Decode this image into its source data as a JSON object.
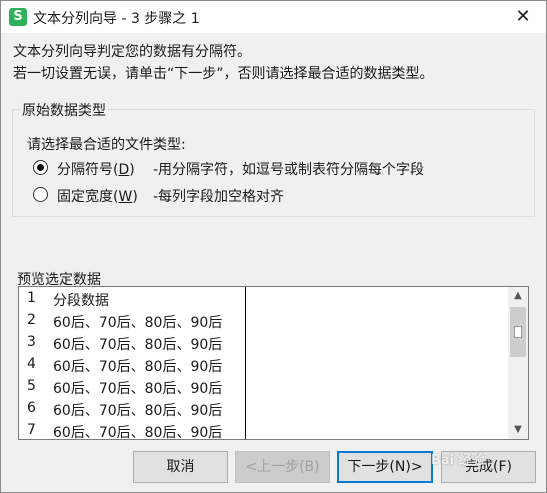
{
  "window": {
    "title": "文本分列向导 - 3 步骤之 1",
    "app_icon_glyph": "S",
    "app_icon_color": "#2fb15a",
    "close_glyph": "✕"
  },
  "intro": {
    "line1": "文本分列向导判定您的数据有分隔符。",
    "line2": "若一切设置无误，请单击“下一步”，否则请选择最合适的数据类型。"
  },
  "group": {
    "legend": "原始数据类型",
    "prompt": "请选择最合适的文件类型:",
    "options": [
      {
        "label": "分隔符号(",
        "key": "D",
        "suffix": ")",
        "description": "-用分隔字符，如逗号或制表符分隔每个字段",
        "selected": true
      },
      {
        "label": "固定宽度(",
        "key": "W",
        "suffix": ")",
        "description": "-每列字段加空格对齐",
        "selected": false
      }
    ]
  },
  "preview": {
    "label": "预览选定数据",
    "rows": [
      {
        "num": "1",
        "text": "分段数据"
      },
      {
        "num": "2",
        "text": "60后、70后、80后、90后"
      },
      {
        "num": "3",
        "text": "60后、70后、80后、90后"
      },
      {
        "num": "4",
        "text": "60后、70后、80后、90后"
      },
      {
        "num": "5",
        "text": "60后、70后、80后、90后"
      },
      {
        "num": "6",
        "text": "60后、70后、80后、90后"
      },
      {
        "num": "7",
        "text": "60后、70后、80后、90后"
      }
    ],
    "scroll_up_glyph": "▲",
    "scroll_down_glyph": "▼"
  },
  "buttons": {
    "cancel": "取消",
    "back": "<上一步(B)",
    "next": "下一步(N)>",
    "finish": "完成(F)"
  },
  "watermark": "Bai 经验"
}
